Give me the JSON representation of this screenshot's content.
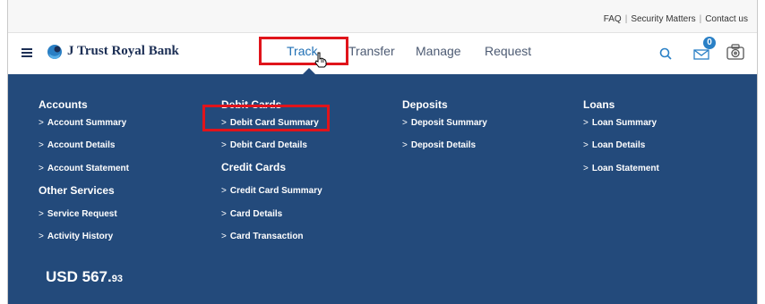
{
  "top_links": [
    "FAQ",
    "Security Matters",
    "Contact us"
  ],
  "brand": {
    "name": "J Trust Royal Bank"
  },
  "nav": {
    "track": "Track",
    "transfer": "Transfer",
    "manage": "Manage",
    "request": "Request"
  },
  "mail_badge": "0",
  "menu": {
    "accounts": {
      "title": "Accounts",
      "items": [
        "Account Summary",
        "Account Details",
        "Account Statement"
      ]
    },
    "other_services": {
      "title": "Other Services",
      "items": [
        "Service Request",
        "Activity History"
      ]
    },
    "debit_cards": {
      "title": "Debit Cards",
      "items": [
        "Debit Card Summary",
        "Debit Card Details"
      ]
    },
    "credit_cards": {
      "title": "Credit Cards",
      "items": [
        "Credit Card Summary",
        "Card Details",
        "Card Transaction"
      ]
    },
    "deposits": {
      "title": "Deposits",
      "items": [
        "Deposit Summary",
        "Deposit Details"
      ]
    },
    "loans": {
      "title": "Loans",
      "items": [
        "Loan Summary",
        "Loan Details",
        "Loan Statement"
      ]
    }
  },
  "balance": {
    "main": "USD 567.",
    "cents": "93"
  },
  "colors": {
    "menu_bg": "#234a7b",
    "highlight": "#e0141b",
    "active_nav": "#1f6fb4",
    "brand": "#1c2f55"
  }
}
